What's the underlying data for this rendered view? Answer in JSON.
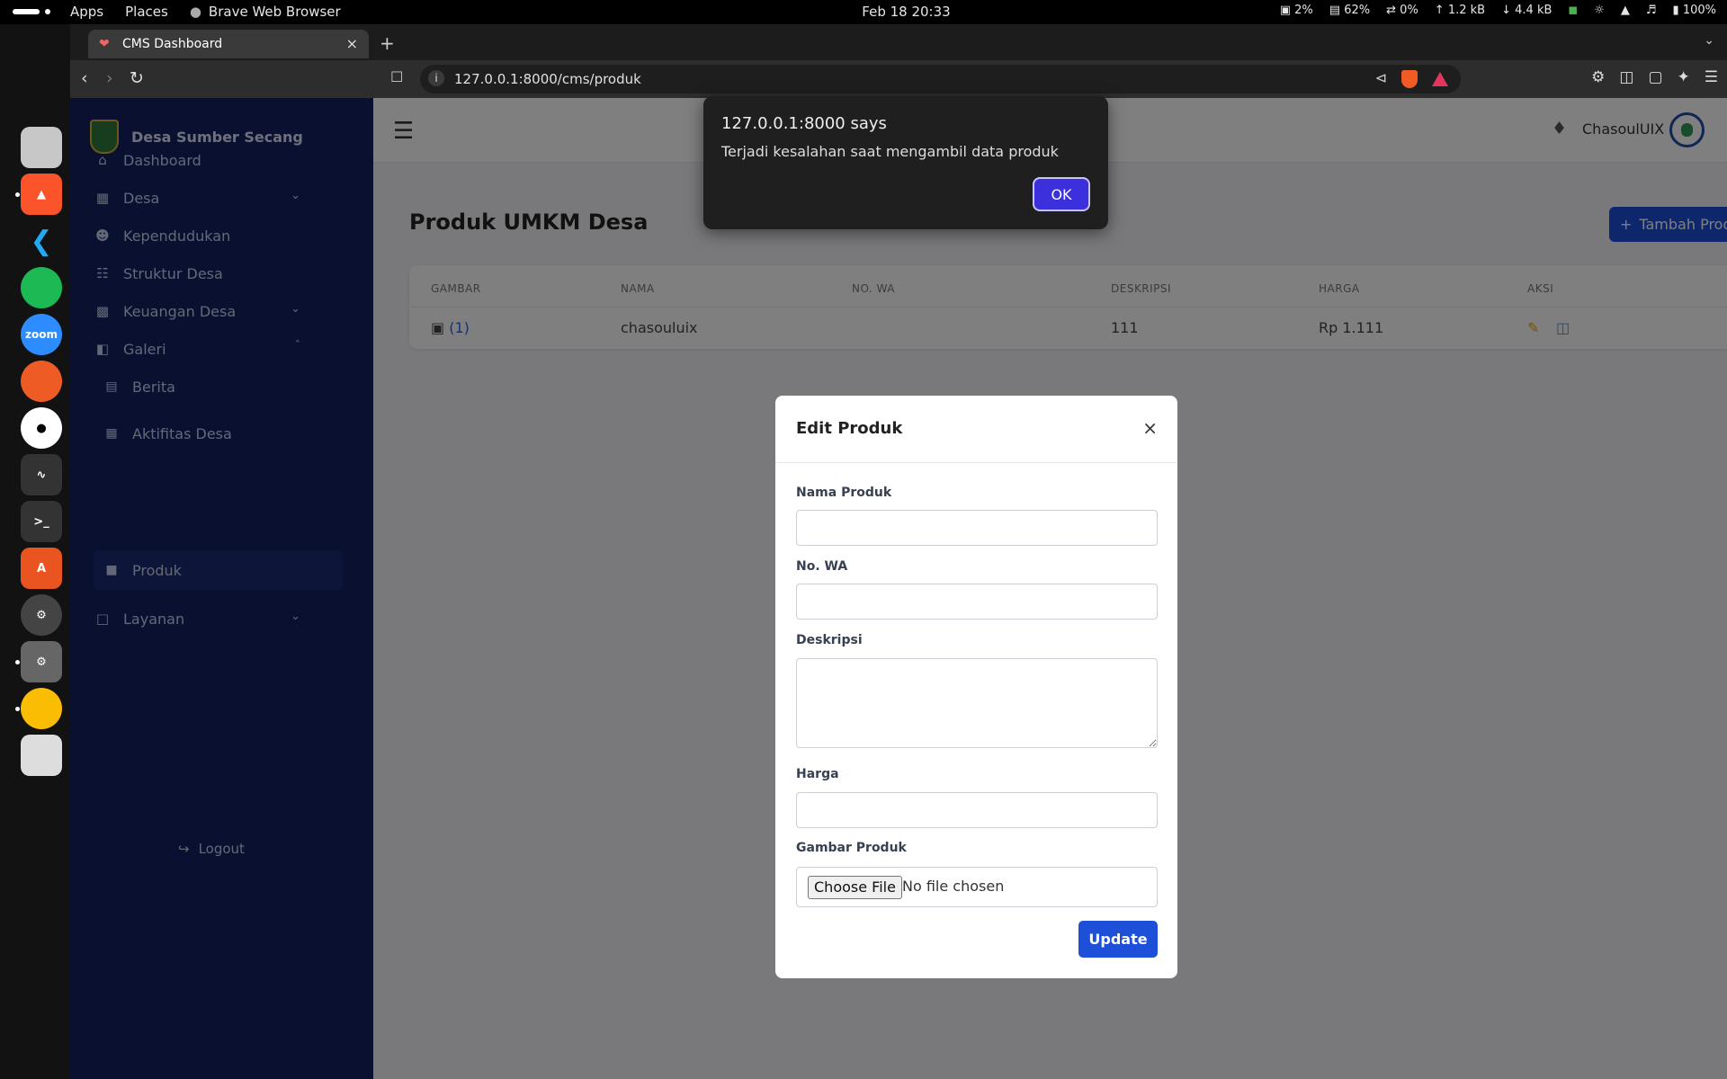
{
  "system": {
    "menu_apps": "Apps",
    "menu_places": "Places",
    "active_app": "Brave Web Browser",
    "datetime": "Feb 18  20:33",
    "cpu": "2%",
    "memory": "62%",
    "swap": "0%",
    "upload": "1.2 kB",
    "download": "4.4 kB",
    "battery": "100%"
  },
  "browser": {
    "tab_title": "CMS Dashboard",
    "url": "127.0.0.1:8000/cms/produk"
  },
  "sidebar": {
    "brand": "Desa Sumber Secang",
    "items": [
      {
        "label": "Dashboard",
        "icon": "home-icon"
      },
      {
        "label": "Desa",
        "icon": "building-icon"
      },
      {
        "label": "Kependudukan",
        "icon": "users-icon"
      },
      {
        "label": "Struktur Desa",
        "icon": "sitemap-icon"
      },
      {
        "label": "Keuangan Desa",
        "icon": "money-icon"
      },
      {
        "label": "Galeri",
        "icon": "images-icon"
      },
      {
        "label": "Layanan",
        "icon": "file-icon"
      }
    ],
    "sub_items": [
      {
        "label": "Berita",
        "icon": "newspaper-icon"
      },
      {
        "label": "Aktifitas Desa",
        "icon": "calendar-icon"
      },
      {
        "label": "Produk",
        "icon": "box-icon"
      }
    ],
    "logout": "Logout"
  },
  "header": {
    "username": "ChasoulUIX"
  },
  "main": {
    "title": "Produk UMKM Desa",
    "add_button": "Tambah Produk",
    "table": {
      "columns": [
        "GAMBAR",
        "NAMA",
        "NO. WA",
        "DESKRIPSI",
        "HARGA",
        "AKSI"
      ],
      "rows": [
        {
          "gambar_count": "(1)",
          "nama": "chasouluix",
          "deskripsi": "111",
          "harga": "Rp 1.111"
        }
      ]
    }
  },
  "modal": {
    "title": "Edit Produk",
    "fields": {
      "nama": {
        "label": "Nama Produk",
        "value": ""
      },
      "wa": {
        "label": "No. WA",
        "value": ""
      },
      "deskripsi": {
        "label": "Deskripsi",
        "value": ""
      },
      "harga": {
        "label": "Harga",
        "value": ""
      },
      "gambar": {
        "label": "Gambar Produk",
        "button": "Choose File",
        "status": "No file chosen"
      }
    },
    "submit": "Update"
  },
  "alert": {
    "heading": "127.0.0.1:8000 says",
    "message": "Terjadi kesalahan saat mengambil data produk",
    "ok": "OK"
  }
}
